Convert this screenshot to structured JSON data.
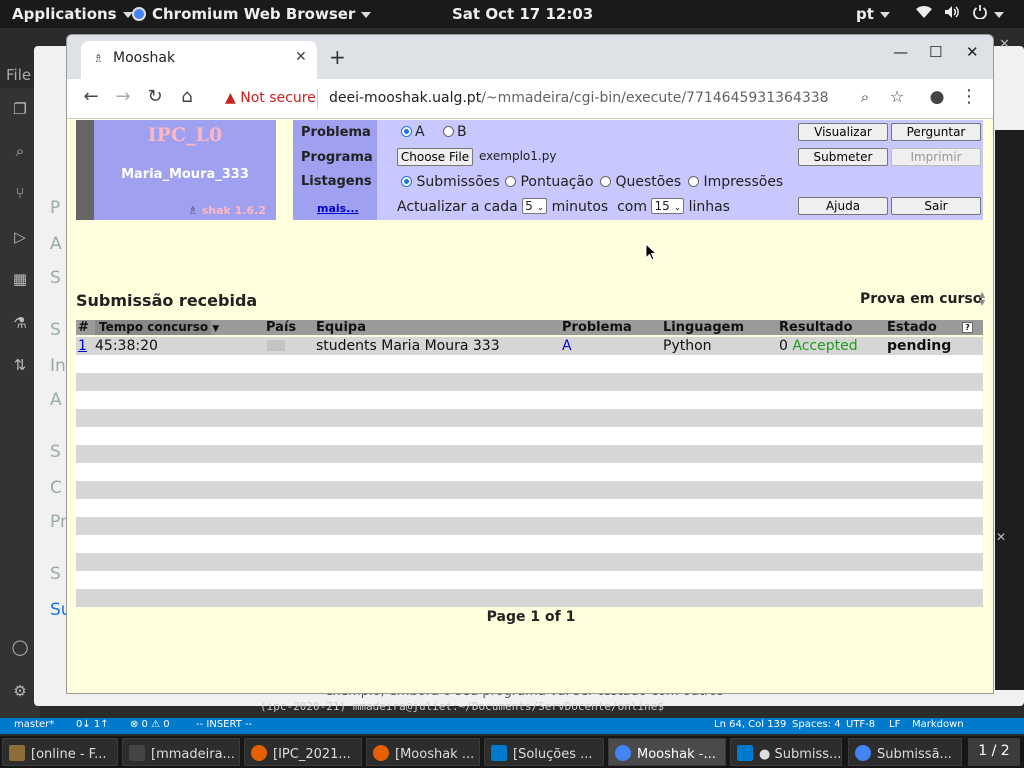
{
  "topbar": {
    "applications": "Applications",
    "browser_menu": "Chromium Web Browser",
    "clock": "Sat Oct 17  12:03",
    "lang": "pt"
  },
  "background": {
    "file_menu": "File",
    "left_letters": [
      "P",
      "A",
      "S",
      "S",
      "In",
      "A",
      "S",
      "C",
      "Pr",
      "S",
      "Su"
    ],
    "bottom_text": "exemplo, embora o seu programa vai ser testado com outros",
    "terminal": "(ipc-2020-21) mmadeira@juliet:~/Documents/ServDocente/online$",
    "status": {
      "branch": "master*",
      "sync": "0↓ 1↑",
      "problems": "⊗ 0 ⚠ 0",
      "mode": "-- INSERT --",
      "position": "Ln 64, Col 139",
      "spaces": "Spaces: 4",
      "encoding": "UTF-8",
      "eol": "LF",
      "language": "Markdown"
    }
  },
  "taskbar": {
    "tasks": [
      {
        "label": "[online - F...",
        "color": "#8a6d3b"
      },
      {
        "label": "[mmadeira...",
        "color": "#444"
      },
      {
        "label": "[IPC_2021...",
        "color": "#e66000"
      },
      {
        "label": "[Mooshak ...",
        "color": "#e66000"
      },
      {
        "label": "[Soluções ...",
        "color": "#007acc"
      },
      {
        "label": "Mooshak -...",
        "color": "#4285f4"
      },
      {
        "label": "● Submiss...",
        "color": "#007acc"
      },
      {
        "label": "Submissã...",
        "color": "#4285f4"
      }
    ],
    "pager": "1 / 2"
  },
  "browser": {
    "tab_title": "Mooshak",
    "not_secure": "Not secure",
    "url_host": "deei-mooshak.ualg.pt",
    "url_path": "/~mmadeira/cgi-bin/execute/7714645931364338"
  },
  "mooshak": {
    "contest": "IPC_L0",
    "user": "Maria_Moura_333",
    "version": "shak 1.6.2",
    "labels": {
      "problema": "Problema",
      "programa": "Programa",
      "listagens": "Listagens",
      "mais": "mais..."
    },
    "problems": [
      {
        "label": "A",
        "selected": true
      },
      {
        "label": "B",
        "selected": false
      }
    ],
    "choose_file": "Choose File",
    "file_name": "exemplo1.py",
    "listings": [
      {
        "label": "Submissões",
        "selected": true
      },
      {
        "label": "Pontuação",
        "selected": false
      },
      {
        "label": "Questões",
        "selected": false
      },
      {
        "label": "Impressões",
        "selected": false
      }
    ],
    "refresh": {
      "prefix": "Actualizar a cada",
      "minutes_value": "5",
      "minutes_label": "minutos",
      "with": "com",
      "lines_value": "15",
      "lines_label": "linhas"
    },
    "buttons": {
      "visualizar": "Visualizar",
      "perguntar": "Perguntar",
      "submeter": "Submeter",
      "imprimir": "Imprimir",
      "ajuda": "Ajuda",
      "sair": "Sair"
    },
    "heading": "Submissão recebida",
    "status_text": "Prova em curso",
    "table": {
      "columns": [
        "#",
        "Tempo concurso",
        "País",
        "Equipa",
        "Problema",
        "Linguagem",
        "Resultado",
        "Estado"
      ],
      "rows": [
        {
          "num": "1",
          "time": "45:38:20",
          "country": "",
          "team": "students Maria Moura 333",
          "problem": "A",
          "language": "Python",
          "result_points": "0",
          "result_text": "Accepted",
          "state": "pending"
        }
      ]
    },
    "pagination": "Page 1 of 1"
  }
}
